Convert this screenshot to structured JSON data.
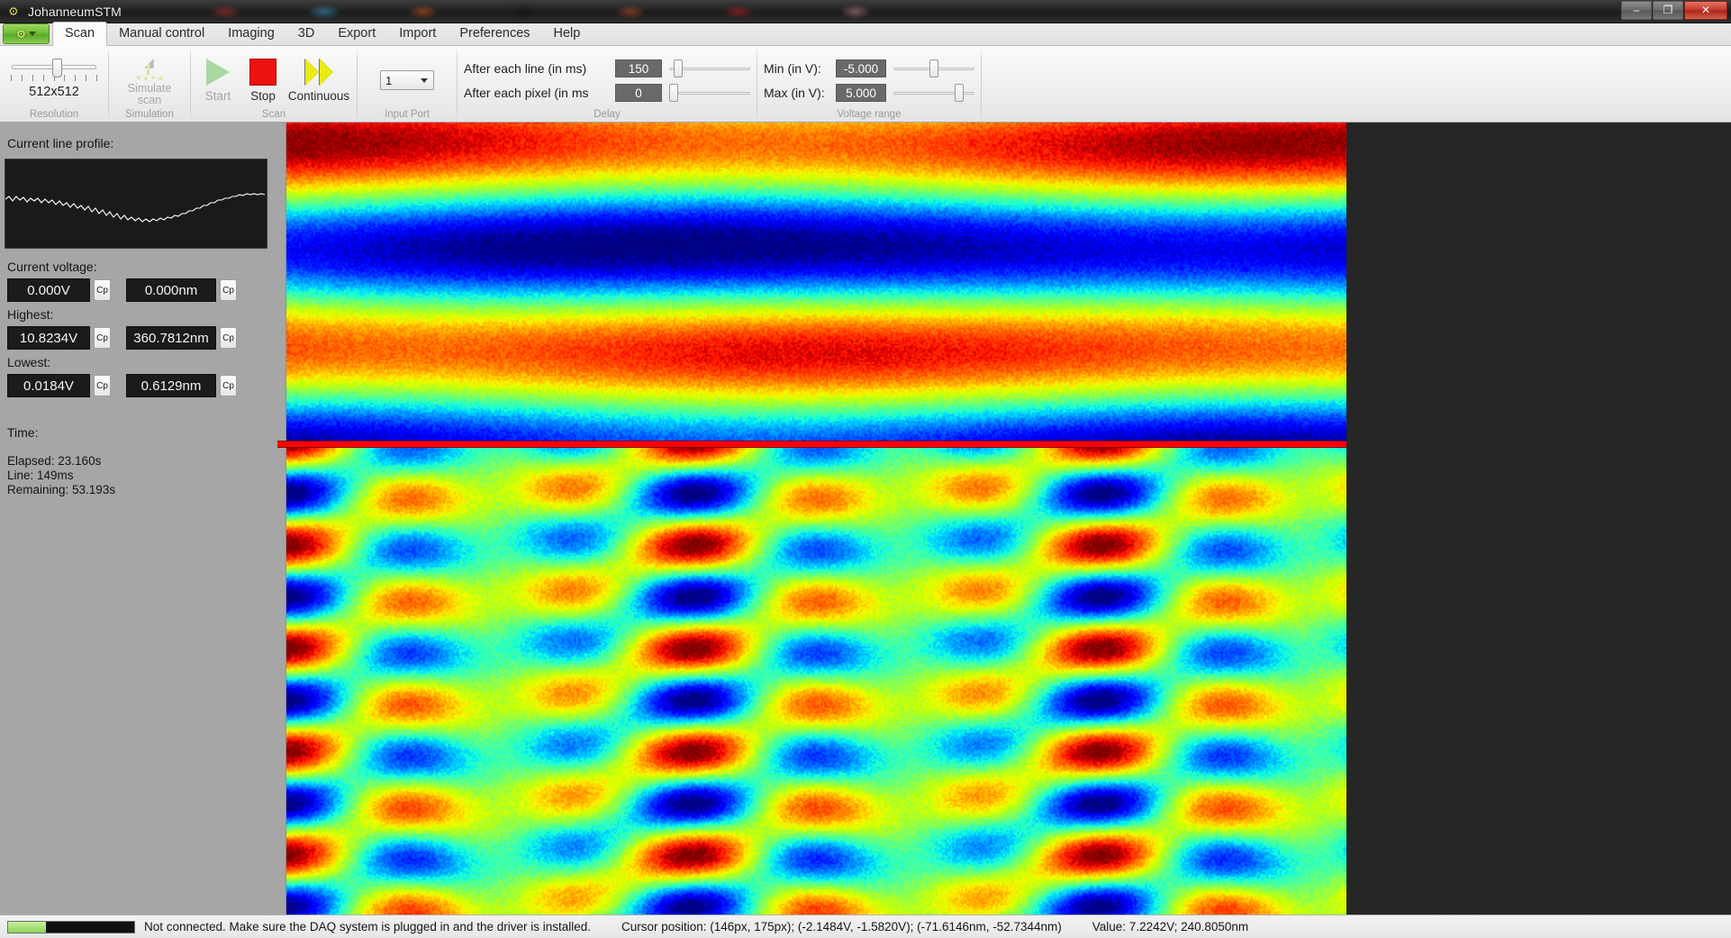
{
  "window": {
    "title": "JohanneumSTM",
    "app_icon": "stm-tip-icon",
    "minimize_label": "–",
    "restore_label": "❐",
    "close_label": "✕"
  },
  "tabs": {
    "app_button_label": "app-menu",
    "items": [
      {
        "label": "Scan",
        "active": true
      },
      {
        "label": "Manual control",
        "active": false
      },
      {
        "label": "Imaging",
        "active": false
      },
      {
        "label": "3D",
        "active": false
      },
      {
        "label": "Export",
        "active": false
      },
      {
        "label": "Import",
        "active": false
      },
      {
        "label": "Preferences",
        "active": false
      },
      {
        "label": "Help",
        "active": false
      }
    ]
  },
  "ribbon": {
    "resolution": {
      "caption": "Resolution",
      "value": "512x512",
      "tick_count": 9,
      "thumb_index": 4
    },
    "simulation": {
      "caption": "Simulation",
      "button_line1": "Simulate",
      "button_line2": "scan",
      "enabled": false
    },
    "scan": {
      "caption": "Scan",
      "start_label": "Start",
      "stop_label": "Stop",
      "continuous_label": "Continuous",
      "start_enabled": false
    },
    "input_port": {
      "caption": "Input Port",
      "value": "1"
    },
    "delay": {
      "caption": "Delay",
      "after_line_label": "After each line (in ms)",
      "after_line_value": "150",
      "after_line_slider_pct": 7,
      "after_pixel_label": "After each pixel (in ms",
      "after_pixel_value": "0",
      "after_pixel_slider_pct": 0
    },
    "voltage_range": {
      "caption": "Voltage range",
      "min_label": "Min (in V):",
      "min_value": "-5.000",
      "min_slider_pct": 48,
      "max_label": "Max (in V):",
      "max_value": "5.000",
      "max_slider_pct": 78
    }
  },
  "sidebar": {
    "profile_title": "Current line profile:",
    "current_voltage_title": "Current voltage:",
    "current_voltage": "0.000V",
    "current_distance": "0.000nm",
    "highest_title": "Highest:",
    "highest_voltage": "10.8234V",
    "highest_distance": "360.7812nm",
    "lowest_title": "Lowest:",
    "lowest_voltage": "0.0184V",
    "lowest_distance": "0.6129nm",
    "copy_button_label": "Cp",
    "time_title": "Time:",
    "elapsed": "Elapsed: 23.160s",
    "line": "Line: 149ms",
    "remaining": "Remaining: 53.193s"
  },
  "scan_view": {
    "image_name": "stm-scan-heightmap",
    "scanline_y_pct": 40.2,
    "colormap": "jet"
  },
  "statusbar": {
    "progress_pct": 30,
    "connection_message": "Not connected. Make sure the DAQ system is plugged in and the driver is installed.",
    "cursor_position": "Cursor position: (146px, 175px);  (-2.1484V, -1.5820V);  (-71.6146nm, -52.7344nm)",
    "value": "Value: 7.2242V; 240.8050nm"
  },
  "colors": {
    "accent_green": "#71bd34",
    "stop_red": "#ee1111",
    "continuous_yellow": "#e8ec10",
    "scanline_red": "#ff0000",
    "panel_gray": "#a6a6a6",
    "canvas_bg": "#262626"
  }
}
